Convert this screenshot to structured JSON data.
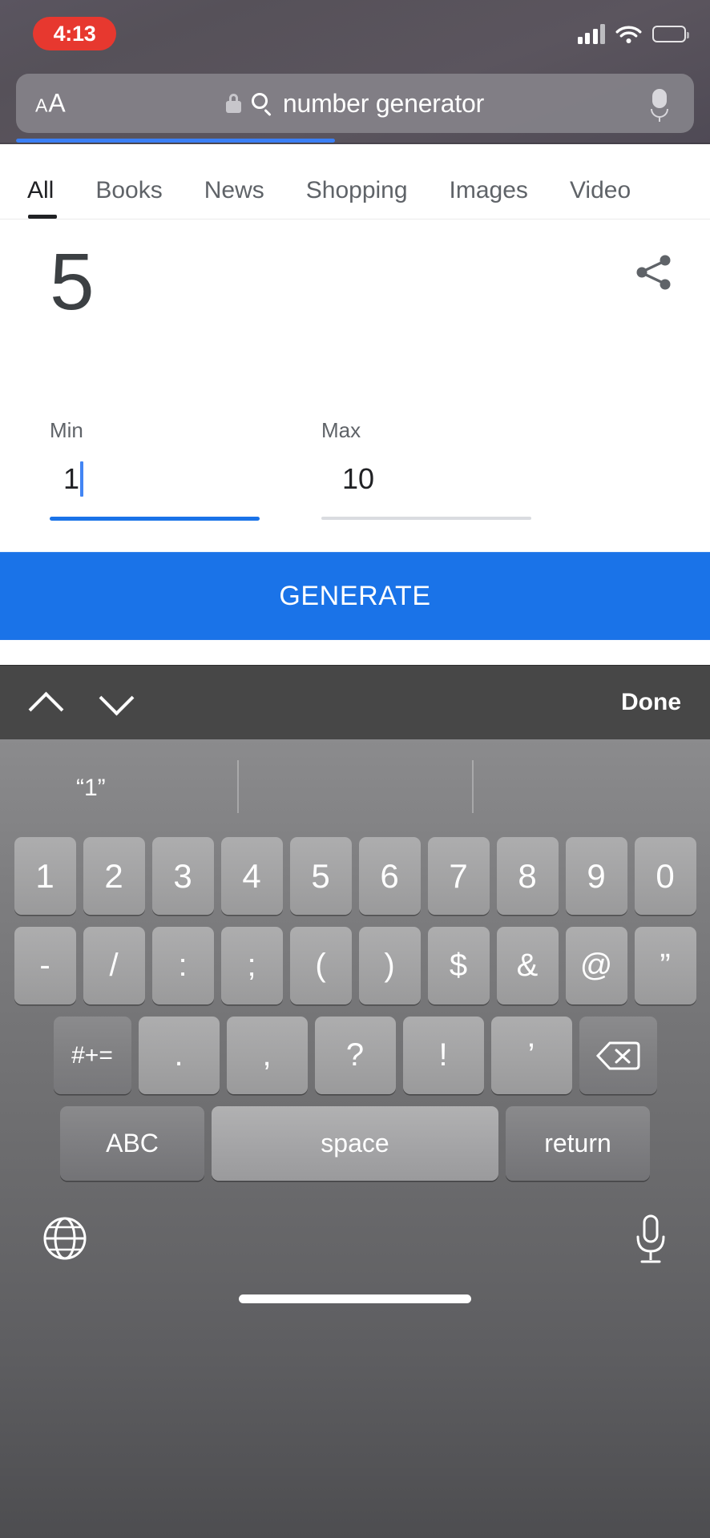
{
  "status_bar": {
    "time": "4:13",
    "signal_icon": "cellular-signal-icon",
    "wifi_icon": "wifi-icon",
    "battery_icon": "battery-icon"
  },
  "browser": {
    "text_size_small": "A",
    "text_size_large": "A",
    "lock_icon": "lock-icon",
    "search_icon": "search-icon",
    "url_text": "number generator",
    "mic_icon": "microphone-icon",
    "progress_percent": 47
  },
  "tabs": [
    {
      "label": "All",
      "active": true
    },
    {
      "label": "Books",
      "active": false
    },
    {
      "label": "News",
      "active": false
    },
    {
      "label": "Shopping",
      "active": false
    },
    {
      "label": "Images",
      "active": false
    },
    {
      "label": "Video",
      "active": false
    }
  ],
  "generator": {
    "result": "5",
    "share_icon": "share-icon",
    "min": {
      "label": "Min",
      "value": "1",
      "focused": true
    },
    "max": {
      "label": "Max",
      "value": "10",
      "focused": false
    },
    "generate_label": "GENERATE",
    "expander_icon": "chevron-down-icon",
    "accent_color": "#1a73e8",
    "inactive_underline_color": "#dadce0"
  },
  "keyboard_toolbar": {
    "prev_icon": "chevron-up-icon",
    "next_icon": "chevron-down-icon",
    "done_label": "Done"
  },
  "keyboard": {
    "prediction": "“1”",
    "row_numbers": [
      "1",
      "2",
      "3",
      "4",
      "5",
      "6",
      "7",
      "8",
      "9",
      "0"
    ],
    "row_symbols": [
      "-",
      "/",
      ":",
      ";",
      "(",
      ")",
      "$",
      "&",
      "@",
      "”"
    ],
    "row_third": {
      "fn_label": "#+=",
      "keys": [
        ".",
        ",",
        "?",
        "!",
        "’"
      ],
      "delete_icon": "backspace-icon"
    },
    "row_bottom": {
      "abc_label": "ABC",
      "space_label": "space",
      "return_label": "return"
    },
    "globe_icon": "globe-icon",
    "mic_icon": "microphone-icon",
    "home_indicator": "home-indicator"
  }
}
